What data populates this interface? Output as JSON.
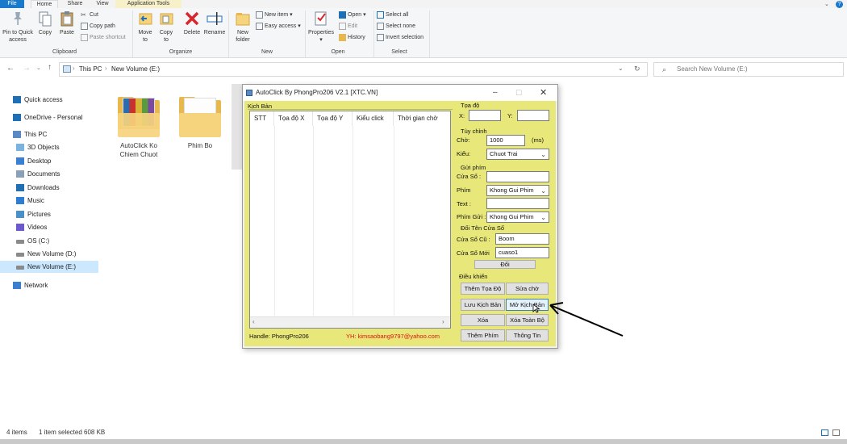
{
  "ribbon_tabs": [
    "File",
    "Home",
    "Share",
    "View",
    "Application Tools"
  ],
  "ribbon": {
    "clipboard": {
      "pin_label_1": "Pin to Quick",
      "pin_label_2": "access",
      "copy": "Copy",
      "paste": "Paste",
      "cut": "Cut",
      "copy_path": "Copy path",
      "paste_shortcut": "Paste shortcut",
      "group": "Clipboard"
    },
    "organize": {
      "move_1": "Move",
      "move_2": "to",
      "copy_1": "Copy",
      "copy_2": "to",
      "delete": "Delete",
      "rename": "Rename",
      "group": "Organize"
    },
    "new": {
      "folder_1": "New",
      "folder_2": "folder",
      "new_item": "New item",
      "easy_access": "Easy access",
      "group": "New"
    },
    "open": {
      "properties": "Properties",
      "open": "Open",
      "edit": "Edit",
      "history": "History",
      "group": "Open"
    },
    "select": {
      "select_all": "Select all",
      "select_none": "Select none",
      "invert": "Invert selection",
      "group": "Select"
    }
  },
  "address": {
    "crumbs": [
      "This PC",
      "New Volume (E:)"
    ],
    "search_placeholder": "Search New Volume (E:)"
  },
  "sidebar": [
    {
      "label": "Quick access",
      "icon": "star-icon"
    },
    {
      "label": "OneDrive - Personal",
      "icon": "cloud-icon"
    },
    {
      "label": "This PC",
      "icon": "computer-icon"
    },
    {
      "label": "3D Objects",
      "icon": "cube-icon"
    },
    {
      "label": "Desktop",
      "icon": "desktop-icon"
    },
    {
      "label": "Documents",
      "icon": "document-icon"
    },
    {
      "label": "Downloads",
      "icon": "download-icon"
    },
    {
      "label": "Music",
      "icon": "music-icon"
    },
    {
      "label": "Pictures",
      "icon": "picture-icon"
    },
    {
      "label": "Videos",
      "icon": "video-icon"
    },
    {
      "label": "OS (C:)",
      "icon": "drive-icon"
    },
    {
      "label": "New Volume (D:)",
      "icon": "drive-icon"
    },
    {
      "label": "New Volume (E:)",
      "icon": "drive-icon"
    },
    {
      "label": "Network",
      "icon": "network-icon"
    }
  ],
  "files": [
    {
      "label_1": "AutoClick Ko",
      "label_2": "Chiem Chuot"
    },
    {
      "label_1": "Phim Bo",
      "label_2": ""
    }
  ],
  "status": {
    "items": "4 items",
    "selected": "1 item selected  608 KB"
  },
  "dialog": {
    "title": "AutoClick By PhongPro206 V2.1 [XTC.VN]",
    "script_label": "Kịch Bản",
    "columns": [
      "STT",
      "Tọa độ X",
      "Tọa độ Y",
      "Kiểu click",
      "Thời gian chờ"
    ],
    "coord_label": "Tọa độ",
    "x_label": "X:",
    "y_label": "Y:",
    "custom_label": "Tùy chỉnh",
    "wait_label": "Chờ:",
    "wait_value": "1000",
    "ms_label": "(ms)",
    "type_label": "Kiểu:",
    "type_value": "Chuot Trai",
    "sendkey_label": "Gửi phím",
    "window_label": "Cửa Sổ :",
    "key_label": "Phím",
    "key_value": "Khong Gui Phim",
    "text_label": "Text :",
    "sendkey2_label": "Phím Gửi :",
    "sendkey2_value": "Khong Gui Phim",
    "rename_label": "Đổi Tên Cửa Sổ",
    "oldwin_label": "Cửa Sổ Cũ :",
    "oldwin_value": "Boom",
    "newwin_label": "Cửa Sổ Mới",
    "newwin_value": "cuaso1",
    "rename_btn": "Đổi",
    "control_label": "Điều khiển",
    "add_coord_btn": "Thêm Tọa Độ",
    "edit_wait_btn": "Sửa chờ",
    "save_btn": "Lưu Kịch Bản",
    "open_btn": "Mở Kịch Bản",
    "delete_btn": "Xóa",
    "delete_all_btn": "Xóa Toàn Bộ",
    "add_key_btn": "Thêm Phím",
    "info_btn": "Thông Tin",
    "handle_text": "Handle: PhongPro206",
    "yh_text": "YH: kimsaobang9797@yahoo.com"
  }
}
